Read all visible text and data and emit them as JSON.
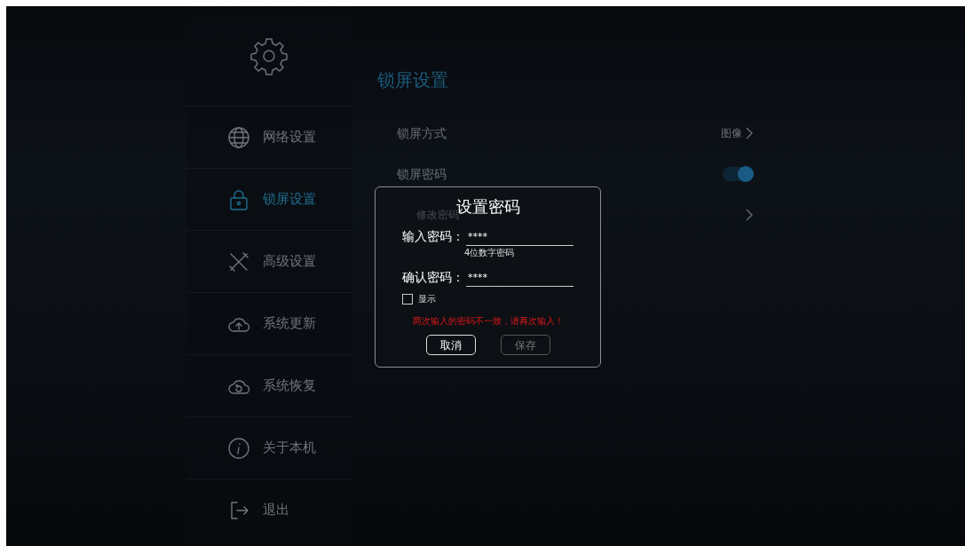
{
  "sidebar": {
    "items": [
      {
        "label": "网络设置",
        "selected": false
      },
      {
        "label": "锁屏设置",
        "selected": true
      },
      {
        "label": "高级设置",
        "selected": false
      },
      {
        "label": "系统更新",
        "selected": false
      },
      {
        "label": "系统恢复",
        "selected": false
      },
      {
        "label": "关于本机",
        "selected": false
      },
      {
        "label": "退出",
        "selected": false
      }
    ]
  },
  "content": {
    "title": "锁屏设置",
    "rows": [
      {
        "kind": "link",
        "label": "锁屏方式",
        "value": "图像"
      },
      {
        "kind": "toggle",
        "label": "锁屏密码",
        "on": true
      },
      {
        "kind": "sublink",
        "label": "修改密码"
      }
    ]
  },
  "dialog": {
    "title": "设置密码",
    "fields": [
      {
        "label": "输入密码：",
        "value": "****",
        "hint": "4位数字密码"
      },
      {
        "label": "确认密码：",
        "value": "****"
      }
    ],
    "show_checkbox": {
      "label": "显示",
      "checked": false
    },
    "error": "两次输入的密码不一致，请再次输入！",
    "buttons": [
      {
        "label": "取消",
        "disabled": false
      },
      {
        "label": "保存",
        "disabled": true
      }
    ]
  }
}
